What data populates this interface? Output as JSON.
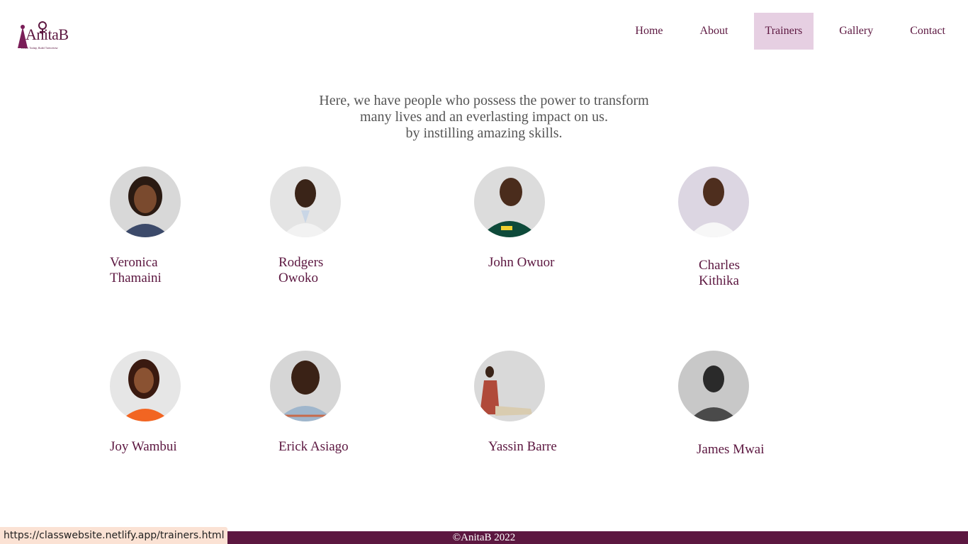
{
  "brand": {
    "logo_text": "AnitaB",
    "logo_tagline": "Learn Today, Build Tomorrow",
    "accent_color": "#5c1740"
  },
  "nav": {
    "items": [
      {
        "label": "Home"
      },
      {
        "label": "About"
      },
      {
        "label": "Trainers",
        "active": true
      },
      {
        "label": "Gallery"
      },
      {
        "label": "Contact"
      }
    ]
  },
  "intro": {
    "line1": "Here, we have people who possess the power to transform",
    "line2": "many lives and an everlasting impact on us.",
    "line3": "by instilling amazing skills."
  },
  "trainers": [
    {
      "name": "Veronica Thamaini"
    },
    {
      "name": "Rodgers Owoko"
    },
    {
      "name": "John Owuor"
    },
    {
      "name": "Charles Kithika"
    },
    {
      "name": "Joy Wambui"
    },
    {
      "name": "Erick Asiago"
    },
    {
      "name": "Yassin Barre"
    },
    {
      "name": "James Mwai"
    }
  ],
  "footer": {
    "copyright": "©AnitaB 2022"
  },
  "status_bar": {
    "url": "https://classwebsite.netlify.app/trainers.html"
  }
}
